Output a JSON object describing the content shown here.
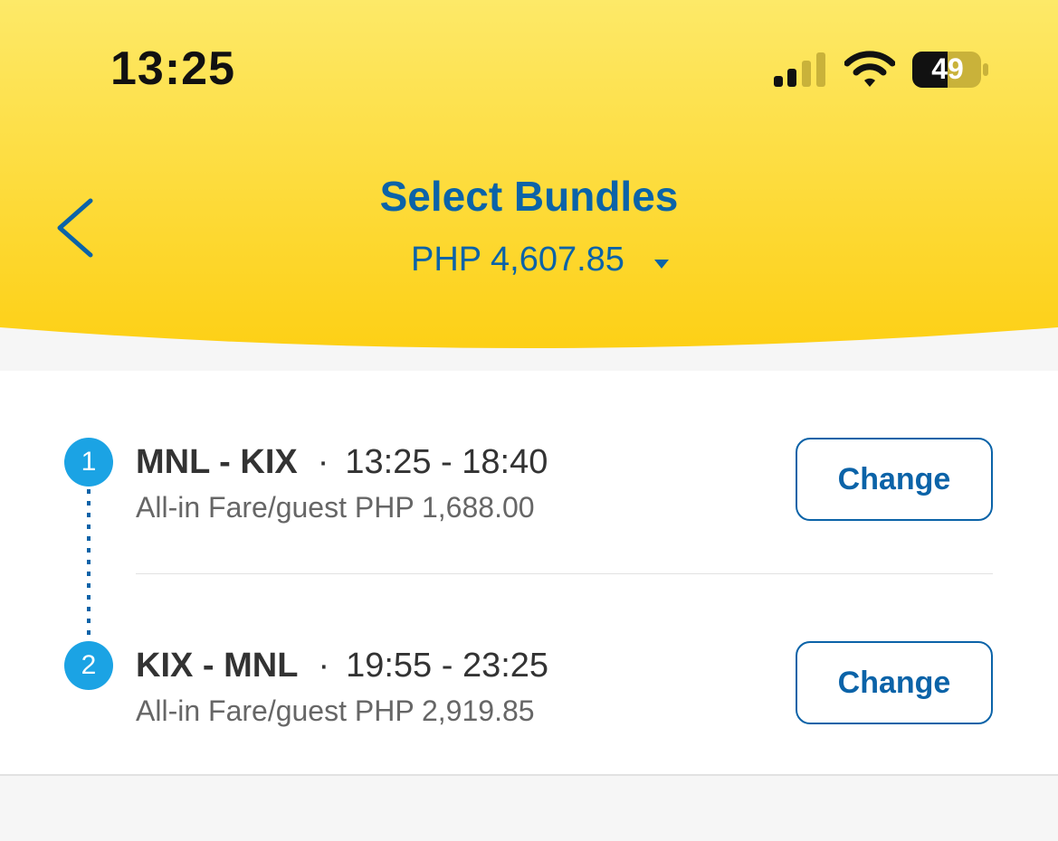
{
  "status_bar": {
    "time": "13:25",
    "battery": "49"
  },
  "header": {
    "title": "Select Bundles",
    "total_price": "PHP 4,607.85"
  },
  "flights": [
    {
      "step": "1",
      "route": "MNL - KIX",
      "separator": "·",
      "times": "13:25 - 18:40",
      "fare": "All-in Fare/guest PHP 1,688.00",
      "action_label": "Change"
    },
    {
      "step": "2",
      "route": "KIX - MNL",
      "separator": "·",
      "times": "19:55 - 23:25",
      "fare": "All-in Fare/guest PHP 2,919.85",
      "action_label": "Change"
    }
  ],
  "colors": {
    "header_yellow_top": "#fde968",
    "header_yellow_bottom": "#fdd016",
    "brand_blue": "#0b63a8",
    "step_blue": "#1ba3e4"
  }
}
